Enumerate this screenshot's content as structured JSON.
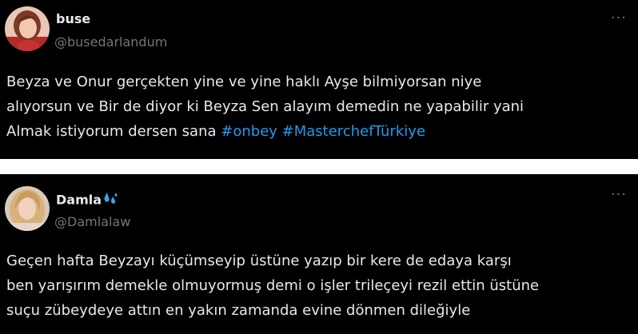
{
  "tweets": [
    {
      "display_name": "buse",
      "handle": "@busedarlandum",
      "more_label": "···",
      "text_lines": [
        "Beyza ve Onur gerçekten yine ve yine haklı Ayşe bilmiyorsan niye",
        "alıyorsun ve Bir de diyor ki Beyza Sen alayım demedin ne yapabilir yani",
        "Almak istiyorum dersen sana"
      ],
      "hashtags": [
        "#onbey",
        "#MasterchefTürkiye"
      ],
      "avatar_icon": "portrait-avatar"
    },
    {
      "display_name": "Damla",
      "handle": "@Damlalaw",
      "more_label": "···",
      "name_emoji_icon": "sweat-droplets-icon",
      "text_lines": [
        "Geçen  hafta Beyzayı küçümseyip üstüne yazıp  bir kere de edaya karşı",
        "ben yarışırım demekle olmuyormuş demi o işler trileçeyi rezil ettin üstüne",
        "suçu zübeydeye attın en yakın zamanda evine dönmen dileğiyle"
      ],
      "avatar_icon": "portrait-avatar"
    }
  ],
  "colors": {
    "background": "#000000",
    "text": "#e7e9ea",
    "muted": "#71767b",
    "link": "#1d9bf0",
    "separator": "#ffffff"
  }
}
